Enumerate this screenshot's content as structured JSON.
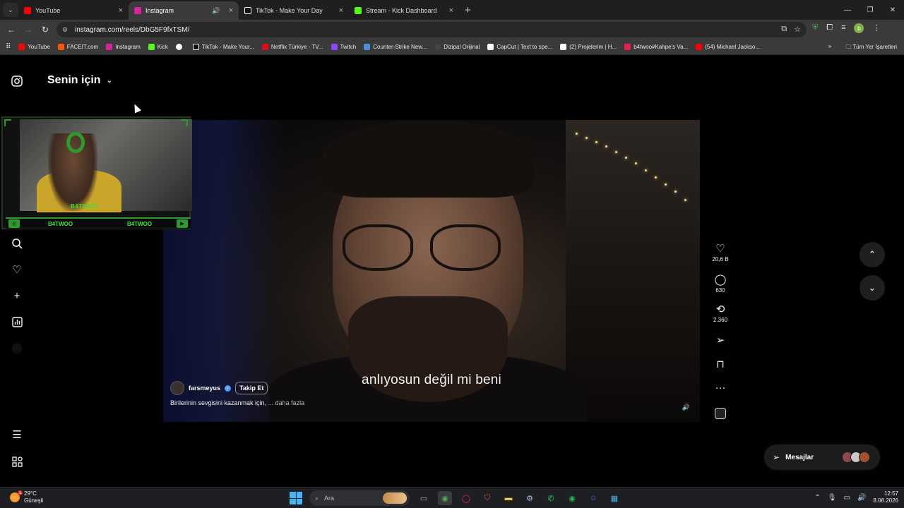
{
  "browser": {
    "tabs": [
      {
        "title": "YouTube",
        "favicon_color": "#ff0000",
        "active": false
      },
      {
        "title": "Instagram",
        "favicon_color": "#d6249f",
        "active": true
      },
      {
        "title": "TikTok - Make Your Day",
        "favicon_color": "#ffffff",
        "active": false
      },
      {
        "title": "Stream - Kick Dashboard",
        "favicon_color": "#53fc18",
        "active": false
      }
    ],
    "url": "instagram.com/reels/DbG5F9fxTSM/",
    "profile_initial": "b",
    "bookmarks": [
      {
        "label": "YouTube",
        "color": "#ff0000"
      },
      {
        "label": "FACEIT.com",
        "color": "#ff5500"
      },
      {
        "label": "Instagram",
        "color": "#d6249f"
      },
      {
        "label": "Kick",
        "color": "#53fc18"
      },
      {
        "label": "",
        "color": "#ffffff"
      },
      {
        "label": "TikTok - Make Your...",
        "color": "#ffffff"
      },
      {
        "label": "Netflix Türkiye - TV...",
        "color": "#e50914"
      },
      {
        "label": "Twitch",
        "color": "#9146ff"
      },
      {
        "label": "Counter-Strike New...",
        "color": "#4a90d9"
      },
      {
        "label": "Dizipal Orijinal",
        "color": "#444444"
      },
      {
        "label": "CapCut | Text to spe...",
        "color": "#ffffff"
      },
      {
        "label": "(2) Projelerim | H...",
        "color": "#ffffff"
      },
      {
        "label": "b4twoo#Kahpe's Va...",
        "color": "#e8204a"
      },
      {
        "label": "(54) Michael Jackso...",
        "color": "#ff0000"
      }
    ],
    "bookmarks_more": "»",
    "all_bookmarks": "Tüm Yer İşaretleri"
  },
  "instagram": {
    "feed_title": "Senin için",
    "reel": {
      "subtitle": "anlıyosun değil mi beni",
      "author": "farsmeyus",
      "follow_label": "Takip Et",
      "caption": "Birilerinin sevgisini kazanmak için,",
      "caption_more": "... daha fazla",
      "likes": "20,6 B",
      "comments": "630",
      "reposts": "2.360"
    },
    "messages_label": "Mesajlar"
  },
  "stream_overlay": {
    "name_cam": "B4TWOO",
    "name_left": "B4TWOO",
    "name_right": "B4TWOO"
  },
  "taskbar": {
    "temperature": "29°C",
    "weather": "Güneşli",
    "weather_badge": "1",
    "search_placeholder": "Ara",
    "time": "12:57",
    "date": "8.08.2026"
  },
  "colors": {
    "accent_green": "#2d9a2d",
    "overlay_text": "#38e038",
    "verified_blue": "#4a9eff"
  }
}
